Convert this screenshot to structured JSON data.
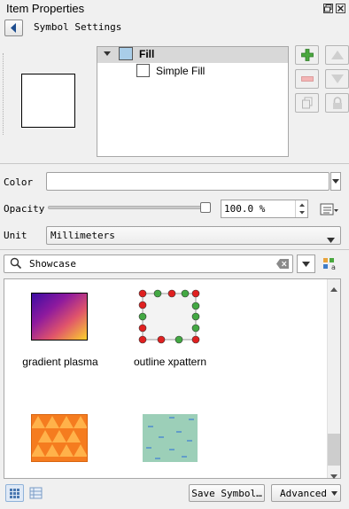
{
  "window": {
    "title": "Item Properties"
  },
  "header": {
    "symbol_settings": "Symbol Settings"
  },
  "layers": [
    {
      "label": "Fill",
      "swatch_color": "#a9cde8",
      "selected": true
    },
    {
      "label": "Simple Fill",
      "swatch_color": "#ffffff",
      "selected": false
    }
  ],
  "form": {
    "color_label": "Color",
    "opacity_label": "Opacity",
    "opacity_value": "100.0 %",
    "opacity_fraction": 1.0,
    "unit_label": "Unit",
    "unit_value": "Millimeters"
  },
  "search": {
    "value": "Showcase"
  },
  "gallery": [
    {
      "label": "gradient  plasma"
    },
    {
      "label": "outline xpattern"
    },
    {
      "label": ""
    },
    {
      "label": ""
    }
  ],
  "buttons": {
    "save_symbol": "Save Symbol…",
    "advanced": "Advanced"
  },
  "colors": {
    "accent_green": "#3ca23c",
    "marker_red": "#e02020",
    "marker_green": "#43a843",
    "orange": "#f57c1f",
    "tile_teal": "#9ccfb8"
  }
}
